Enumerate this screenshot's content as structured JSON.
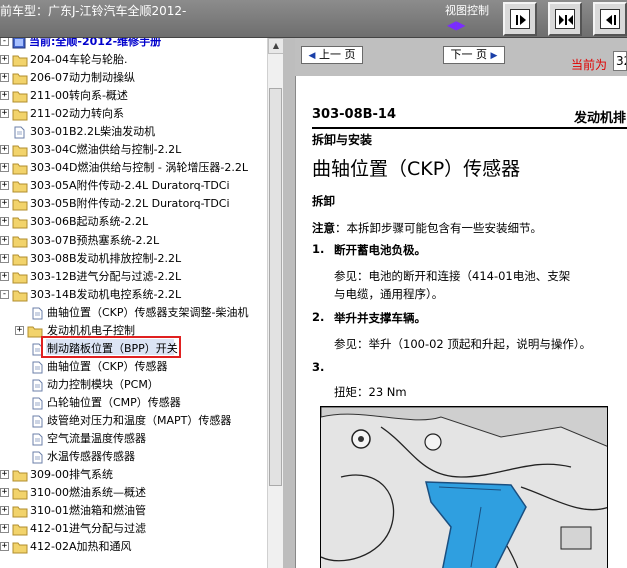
{
  "header": {
    "title": "前车型：广东J-江铃汽车全顺2012-",
    "view_control_label": "视图控制"
  },
  "tree": {
    "root": "当前:全顺-2012-维修手册",
    "items": [
      {
        "label": "204-04车轮与轮胎."
      },
      {
        "label": "206-07动力制动操纵"
      },
      {
        "label": "211-00转向系-概述"
      },
      {
        "label": "211-02动力转向系"
      },
      {
        "label": "303-01B2.2L柴油发动机"
      },
      {
        "label": "303-04C燃油供给与控制-2.2L"
      },
      {
        "label": "303-04D燃油供给与控制 - 涡轮增压器-2.2L"
      },
      {
        "label": "303-05A附件传动-2.4L Duratorq-TDCi"
      },
      {
        "label": "303-05B附件传动-2.2L Duratorq-TDCi"
      },
      {
        "label": "303-06B起动系统-2.2L"
      },
      {
        "label": "303-07B预热塞系统-2.2L"
      },
      {
        "label": "303-08B发动机排放控制-2.2L"
      },
      {
        "label": "303-12B进气分配与过滤-2.2L"
      },
      {
        "label": "303-14B发动机电控系统-2.2L"
      },
      {
        "label": "曲轴位置（CKP）传感器支架调整-柴油机"
      },
      {
        "label": "发动机机电子控制"
      },
      {
        "label": "制动踏板位置（BPP）开关"
      },
      {
        "label": "曲轴位置（CKP）传感器"
      },
      {
        "label": "动力控制模块（PCM）"
      },
      {
        "label": "凸轮轴位置（CMP）传感器"
      },
      {
        "label": "歧管绝对压力和温度（MAPT）传感器"
      },
      {
        "label": "空气流量温度传感器"
      },
      {
        "label": "水温传感器传感器"
      },
      {
        "label": "309-00排气系统"
      },
      {
        "label": "310-00燃油系统—概述"
      },
      {
        "label": "310-01燃油箱和燃油管"
      },
      {
        "label": "412-01进气分配与过滤"
      },
      {
        "label": "412-02A加热和通风"
      }
    ]
  },
  "nav": {
    "prev": "上一 页",
    "next": "下一 页",
    "current_label": "当前为",
    "current_value": "32"
  },
  "doc": {
    "code": "303-08B-14",
    "right_header": "发动机排",
    "section": "拆卸与安装",
    "title": "曲轴位置（CKP）传感器",
    "sub": "拆卸",
    "note_label": "注意",
    "note_text": "：本拆卸步骤可能包含有一些安装细节。",
    "step1_num": "1.",
    "step1": "断开蓄电池负极。",
    "ref1_line1": "参见：电池的断开和连接（414-01电池、支架",
    "ref1_line2": "与电缆，通用程序）。",
    "step2_num": "2.",
    "step2": "举升并支撑车辆。",
    "ref2": "参见：举升（100-02 顶起和升起，说明与操作）。",
    "step3_num": "3.",
    "torque": "扭矩：23 Nm"
  }
}
